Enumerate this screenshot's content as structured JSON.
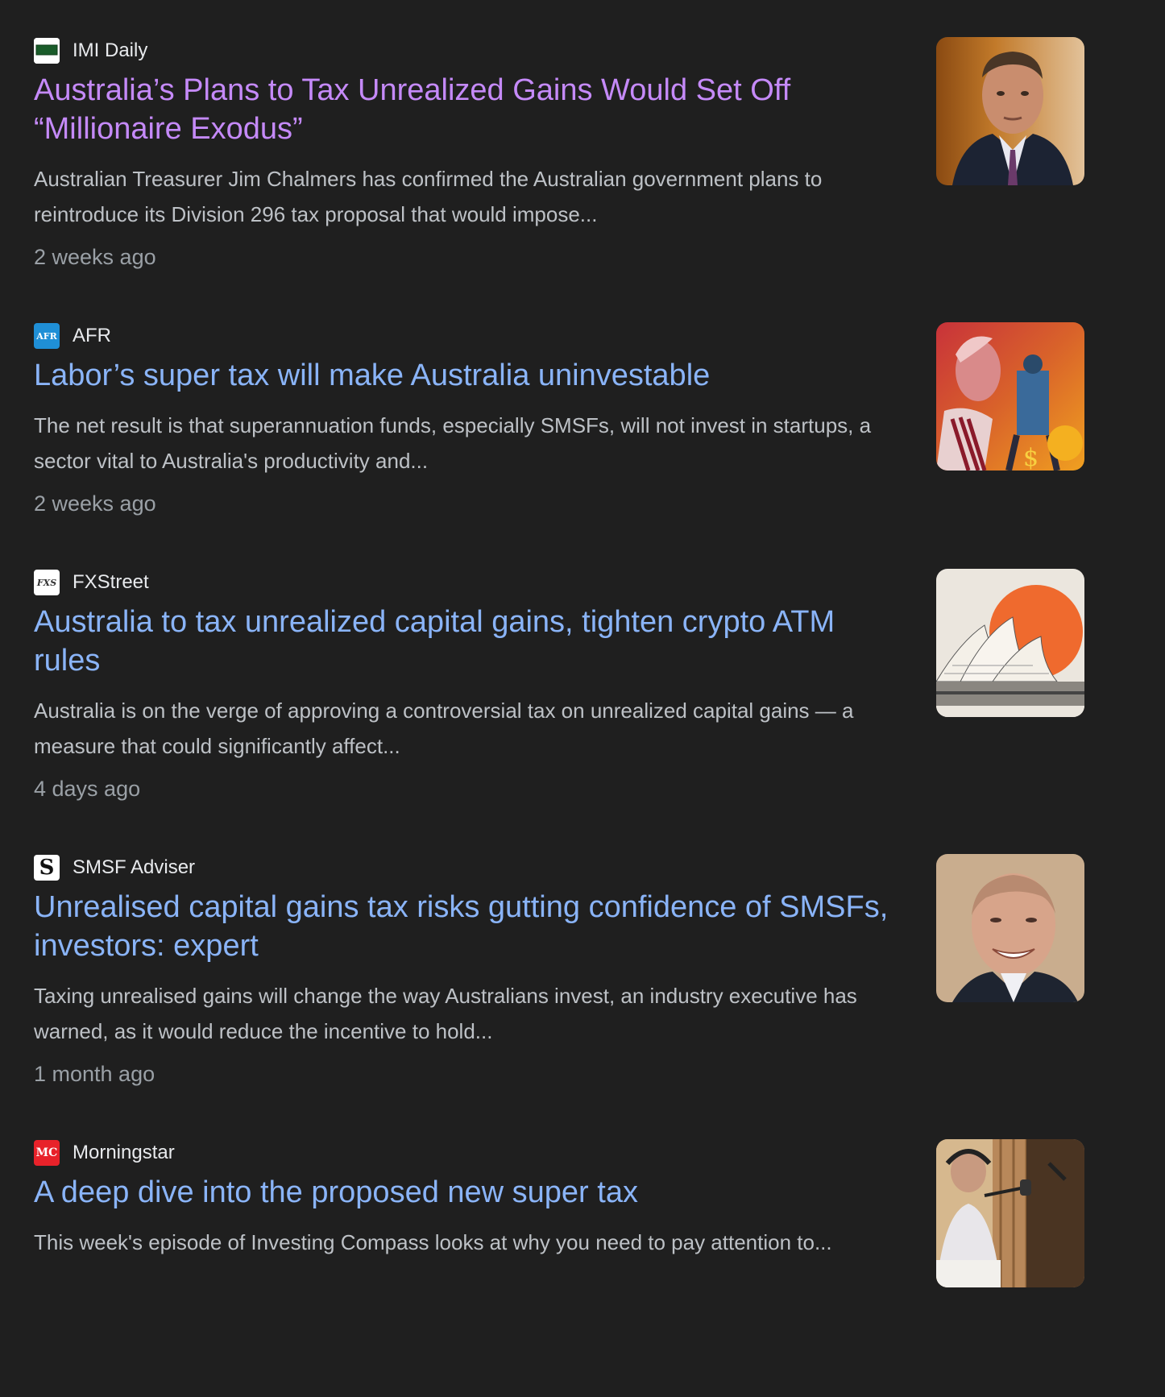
{
  "articles": [
    {
      "source": "IMI Daily",
      "logo_text": "IMI",
      "headline": "Australia’s Plans to Tax Unrealized Gains Would Set Off “Millionaire Exodus”",
      "snippet": "Australian Treasurer Jim Chalmers has confirmed the Australian government plans to reintroduce its Division 296 tax proposal that would impose...",
      "time": "2 weeks ago",
      "visited": true
    },
    {
      "source": "AFR",
      "logo_text": "AFR",
      "headline": "Labor’s super tax will make Australia uninvestable",
      "snippet": "The net result is that superannuation funds, especially SMSFs, will not invest in startups, a sector vital to Australia's productivity and...",
      "time": "2 weeks ago",
      "visited": false
    },
    {
      "source": "FXStreet",
      "logo_text": "FXS",
      "headline": "Australia to tax unrealized capital gains, tighten crypto ATM rules",
      "snippet": "Australia is on the verge of approving a controversial tax on unrealized capital gains — a measure that could significantly affect...",
      "time": "4 days ago",
      "visited": false
    },
    {
      "source": "SMSF Adviser",
      "logo_text": "S",
      "headline": "Unrealised capital gains tax risks gutting confidence of SMSFs, investors: expert",
      "snippet": "Taxing unrealised gains will change the way Australians invest, an industry executive has warned, as it would reduce the incentive to hold...",
      "time": "1 month ago",
      "visited": false
    },
    {
      "source": "Morningstar",
      "logo_text": "MC",
      "headline": "A deep dive into the proposed new super tax",
      "snippet": "This week's episode of Investing Compass looks at why you need to pay attention to...",
      "time": "",
      "visited": false
    }
  ],
  "colors": {
    "background": "#1f1f1f",
    "headline": "#8ab4f8",
    "headline_visited": "#c58af9",
    "snippet": "#bdc1c6",
    "time": "#9aa0a6"
  }
}
